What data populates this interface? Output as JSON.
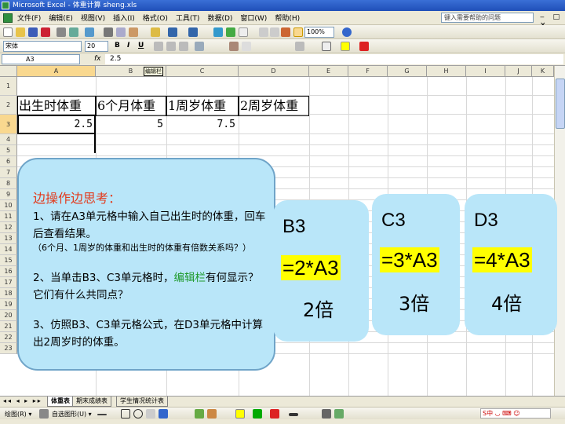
{
  "window": {
    "title": "Microsoft Excel - 体重计算 sheng.xls"
  },
  "menu": {
    "items": [
      "文件(F)",
      "编辑(E)",
      "视图(V)",
      "插入(I)",
      "格式(O)",
      "工具(T)",
      "数据(D)",
      "窗口(W)",
      "帮助(H)"
    ],
    "help_placeholder": "键入需要帮助的问题"
  },
  "toolbar": {
    "zoom": "100%",
    "font": "宋体",
    "size": "20"
  },
  "formula_bar": {
    "name_box": "A3",
    "fx": "fx",
    "value": "2.5"
  },
  "columns": [
    "A",
    "B",
    "C",
    "D",
    "E",
    "F",
    "G",
    "H",
    "I",
    "J",
    "K"
  ],
  "rows": [
    "1",
    "2",
    "3",
    "4",
    "5",
    "6",
    "7",
    "8",
    "9",
    "10",
    "11",
    "12",
    "13",
    "14",
    "15",
    "16",
    "17",
    "18",
    "19",
    "20",
    "21",
    "22",
    "23"
  ],
  "cells": {
    "A2": "出生时体重",
    "B2": "6个月体重",
    "C2": "1周岁体重",
    "D2": "2周岁体重",
    "A3": "2.5",
    "B3": "5",
    "C3": "7.5"
  },
  "tooltip": "编辑栏",
  "sheet_tabs": [
    "体重表",
    "期末成绩表",
    "学生情况统计表"
  ],
  "sheet_nav": "◂◂ ◂ ▸ ▸▸",
  "drawing": {
    "draw_label": "绘图(R) ▾",
    "autoshape_label": "自选图形(U) ▾"
  },
  "ime": "S中 ◡ ⌨ ☺",
  "callout": {
    "title": "边操作边思考：",
    "q1": "1、请在A3单元格中输入自己出生时的体重，回车后查看结果。",
    "note": "（6个月、1周岁的体重和出生时的体重有倍数关系吗？）",
    "q2_pre": "2、当单击B3、C3单元格时，",
    "q2_highlight": "编辑栏",
    "q2_post": "有何显示？它们有什么共同点？",
    "q3": "3、仿照B3、C3单元格公式，在D3单元格中计算出2周岁时的体重。"
  },
  "panels": [
    {
      "ref": "B3",
      "formula": "=2*A3",
      "multiple": "2倍"
    },
    {
      "ref": "C3",
      "formula": "=3*A3",
      "multiple": "3倍"
    },
    {
      "ref": "D3",
      "formula": "=4*A3",
      "multiple": "4倍"
    }
  ],
  "colors": {
    "callout_bg": "#b9e6f9",
    "title_red": "#e23b1d",
    "highlight_green": "#1f9a2c",
    "formula_yellow": "#ffff00"
  }
}
